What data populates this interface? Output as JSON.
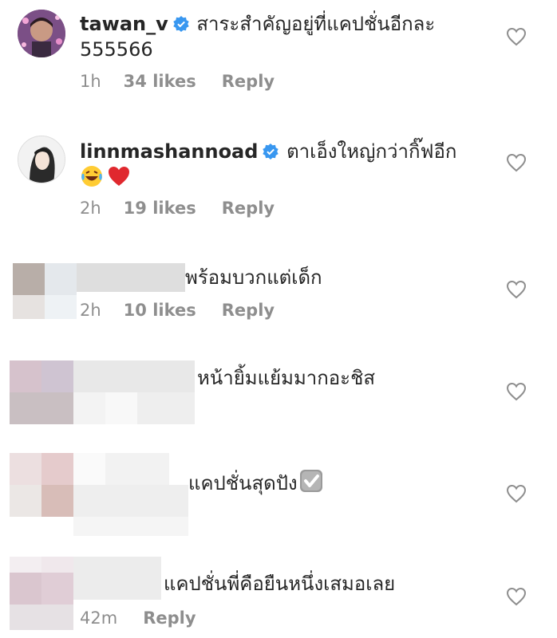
{
  "comments": [
    {
      "username": "tawan_v",
      "verified": true,
      "text_line1": "สาระสำคัญอยู่ที่แคปชั่นอีกละ",
      "text_line2": "555566",
      "time": "1h",
      "likes": "34 likes",
      "reply": "Reply"
    },
    {
      "username": "linnmashannoad",
      "verified": true,
      "text_line1": "ตาเอ็งใหญ่กว่ากิ๊ฟอีก",
      "emojis": [
        "laughing-crying-emoji",
        "red-heart-emoji"
      ],
      "time": "2h",
      "likes": "19 likes",
      "reply": "Reply"
    },
    {
      "username_hidden": true,
      "text_line1": "พร้อมบวกแต่เด็ก",
      "time": "2h",
      "likes": "10 likes",
      "reply": "Reply"
    },
    {
      "username_hidden": true,
      "text_line1": "หน้ายิ้มแย้มมากอะชิส"
    },
    {
      "username_hidden": true,
      "text_line1": "แคปชั่นสุดปัง",
      "emojis": [
        "check-box-emoji"
      ]
    },
    {
      "username_hidden": true,
      "text_line1": "แคปชั่นพี่คือยืนหนึ่งเสมอเลย",
      "time": "42m",
      "reply": "Reply"
    }
  ],
  "colors": {
    "text": "#262626",
    "meta": "#8e8e8e",
    "verified": "#3897f0",
    "heart_outline": "#8e8e8e"
  }
}
